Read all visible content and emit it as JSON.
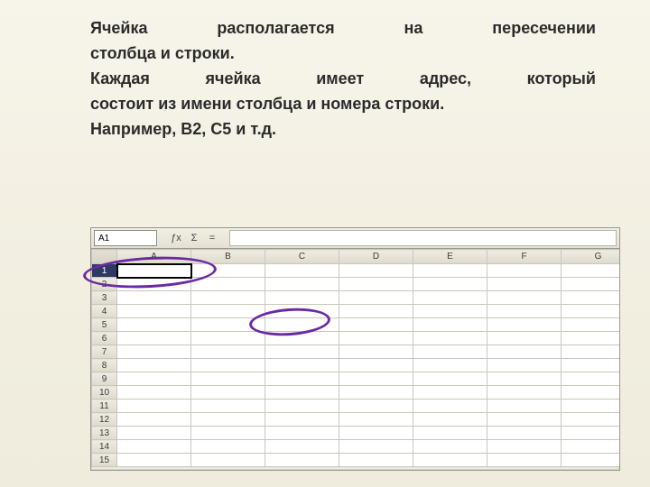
{
  "text": {
    "line1": "Ячейка располагается на пересечении",
    "line2": "столбца и строки.",
    "line3": "Каждая ячейка имеет адрес, который",
    "line4": "состоит из имени столбца и номера строки.",
    "line5": "Например, B2, C5 и т.д."
  },
  "sheet": {
    "name_box": "A1",
    "icons": {
      "fx": "ƒx",
      "sigma": "Σ",
      "eq": "="
    },
    "columns": [
      "A",
      "B",
      "C",
      "D",
      "E",
      "F",
      "G"
    ],
    "rows": [
      "1",
      "2",
      "3",
      "4",
      "5",
      "6",
      "7",
      "8",
      "9",
      "10",
      "11",
      "12",
      "13",
      "14",
      "15"
    ],
    "active_cell": "A1"
  }
}
